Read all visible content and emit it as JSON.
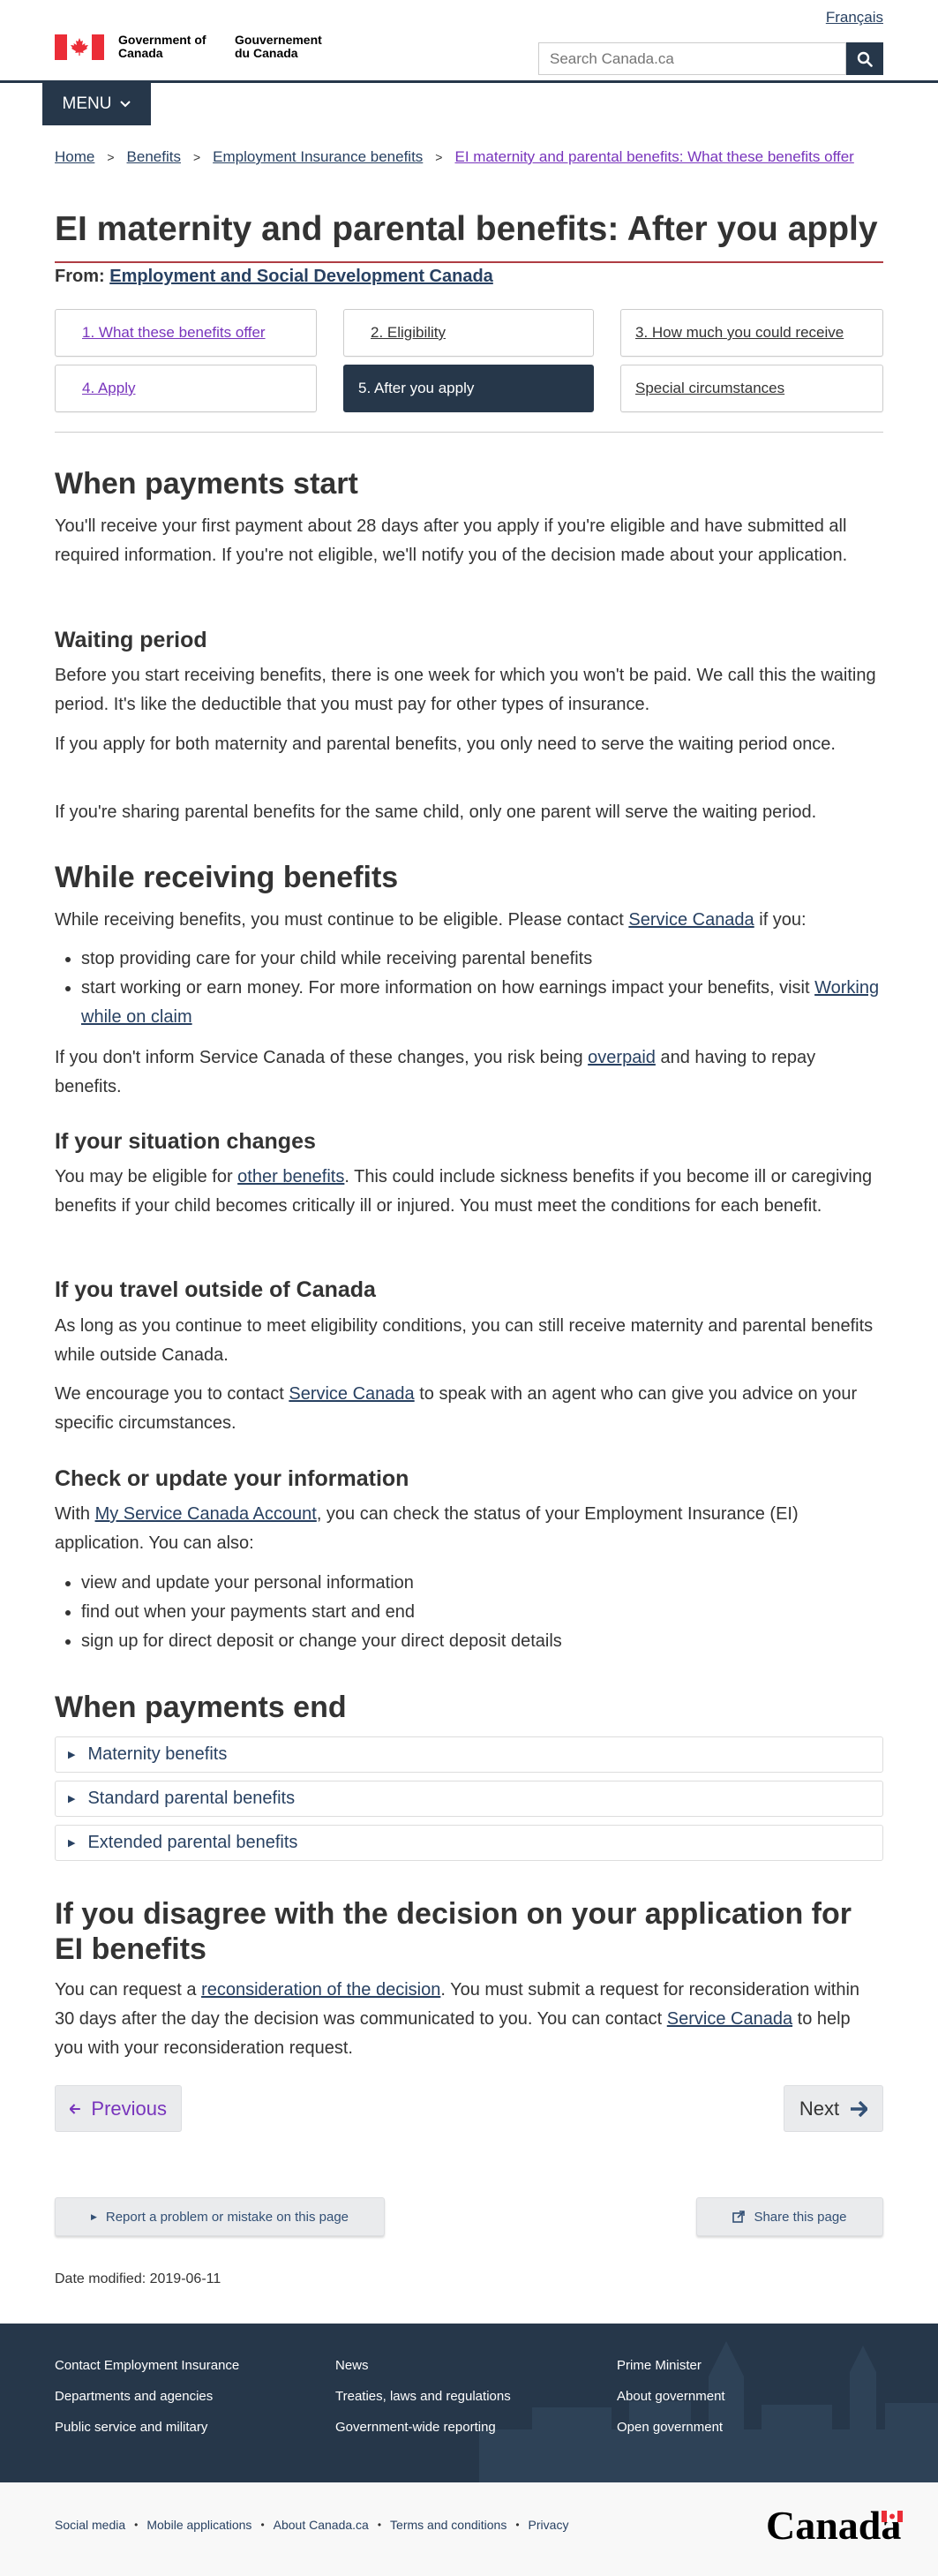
{
  "header": {
    "lang_link": "Français",
    "sig_en": "Government of Canada",
    "sig_fr": "Gouvernement du Canada",
    "search_placeholder": "Search Canada.ca",
    "menu_label": "MENU"
  },
  "breadcrumb": [
    "Home",
    "Benefits",
    "Employment Insurance benefits",
    "EI maternity and parental benefits: What these benefits offer"
  ],
  "page_title": "EI maternity and parental benefits: After you apply",
  "from_label": "From:",
  "from_link": "Employment and Social Development Canada",
  "steps": [
    "1. What these benefits offer",
    "2. Eligibility",
    "3. How much you could receive",
    "4. Apply",
    "5. After you apply",
    "Special circumstances"
  ],
  "sections": {
    "payments_start": {
      "heading": "When payments start",
      "para": "You'll receive your first payment about 28 days after you apply if you're eligible and have submitted all required information. If you're not eligible, we'll notify you of the decision made about your application."
    },
    "waiting": {
      "heading": "Waiting period",
      "p1": "Before you start receiving benefits, there is one week for which you won't be paid. We call this the waiting period. It's like the deductible that you must pay for other types of insurance.",
      "p2": "If you apply for both maternity and parental benefits, you only need to serve the waiting period once.",
      "p3": "If you're sharing parental benefits for the same child, only one parent will serve the waiting period."
    },
    "receiving": {
      "heading": "While receiving benefits",
      "intro_a": "While receiving benefits, you must continue to be eligible. Please contact ",
      "intro_link": "Service Canada",
      "intro_b": " if you:",
      "bullet1": "stop providing care for your child while receiving parental benefits",
      "bullet2_a": "start working or earn money. For more information on how earnings impact your benefits, visit ",
      "bullet2_link": "Working while on claim",
      "risk_a": "If you don't inform Service Canada of these changes, you risk being ",
      "risk_link": "overpaid",
      "risk_b": " and having to repay benefits."
    },
    "situation": {
      "heading": "If your situation changes",
      "p_a": "You may be eligible for ",
      "p_link": "other benefits",
      "p_b": ". This could include sickness benefits if you become ill or caregiving benefits if your child becomes critically ill or injured. You must meet the conditions for each benefit."
    },
    "travel": {
      "heading": "If you travel outside of Canada",
      "p1": "As long as you continue to meet eligibility conditions, you can still receive maternity and parental benefits while outside Canada.",
      "p2_a": "We encourage you to contact ",
      "p2_link": "Service Canada",
      "p2_b": " to speak with an agent who can give you advice on your specific circumstances."
    },
    "check": {
      "heading": "Check or update your information",
      "p_a": "With ",
      "p_link": "My Service Canada Account",
      "p_b": ", you can check the status of your Employment Insurance (EI) application. You can also:",
      "items": [
        "view and update your personal information",
        "find out when your payments start and end",
        "sign up for direct deposit or change your direct deposit details"
      ]
    },
    "payments_end": {
      "heading": "When payments end",
      "details": [
        "Maternity benefits",
        "Standard parental benefits",
        "Extended parental benefits"
      ]
    },
    "disagree": {
      "heading": "If you disagree with the decision on your application for EI benefits",
      "p_a": "You can request a ",
      "p_link1": "reconsideration of the decision",
      "p_b": ". You must submit a request for reconsideration within 30 days after the day the decision was communicated to you. You can contact ",
      "p_link2": "Service Canada",
      "p_c": " to help you with your reconsideration request."
    }
  },
  "pager": {
    "previous": "Previous",
    "next": "Next"
  },
  "utility": {
    "report": "Report a problem or mistake on this page",
    "share": "Share this page"
  },
  "date_modified": "Date modified: 2019-06-11",
  "footer": {
    "col1": [
      "Contact Employment Insurance",
      "Departments and agencies",
      "Public service and military"
    ],
    "col2": [
      "News",
      "Treaties, laws and regulations",
      "Government-wide reporting"
    ],
    "col3": [
      "Prime Minister",
      "About government",
      "Open government"
    ],
    "sub_links": [
      "Social media",
      "Mobile applications",
      "About Canada.ca",
      "Terms and conditions",
      "Privacy"
    ],
    "wordmark": "Canada"
  },
  "colors": {
    "brand_navy": "#26374a",
    "link": "#284162",
    "visited": "#7834bc",
    "flag_red": "#eb2d37",
    "title_rule": "#af3c43"
  }
}
